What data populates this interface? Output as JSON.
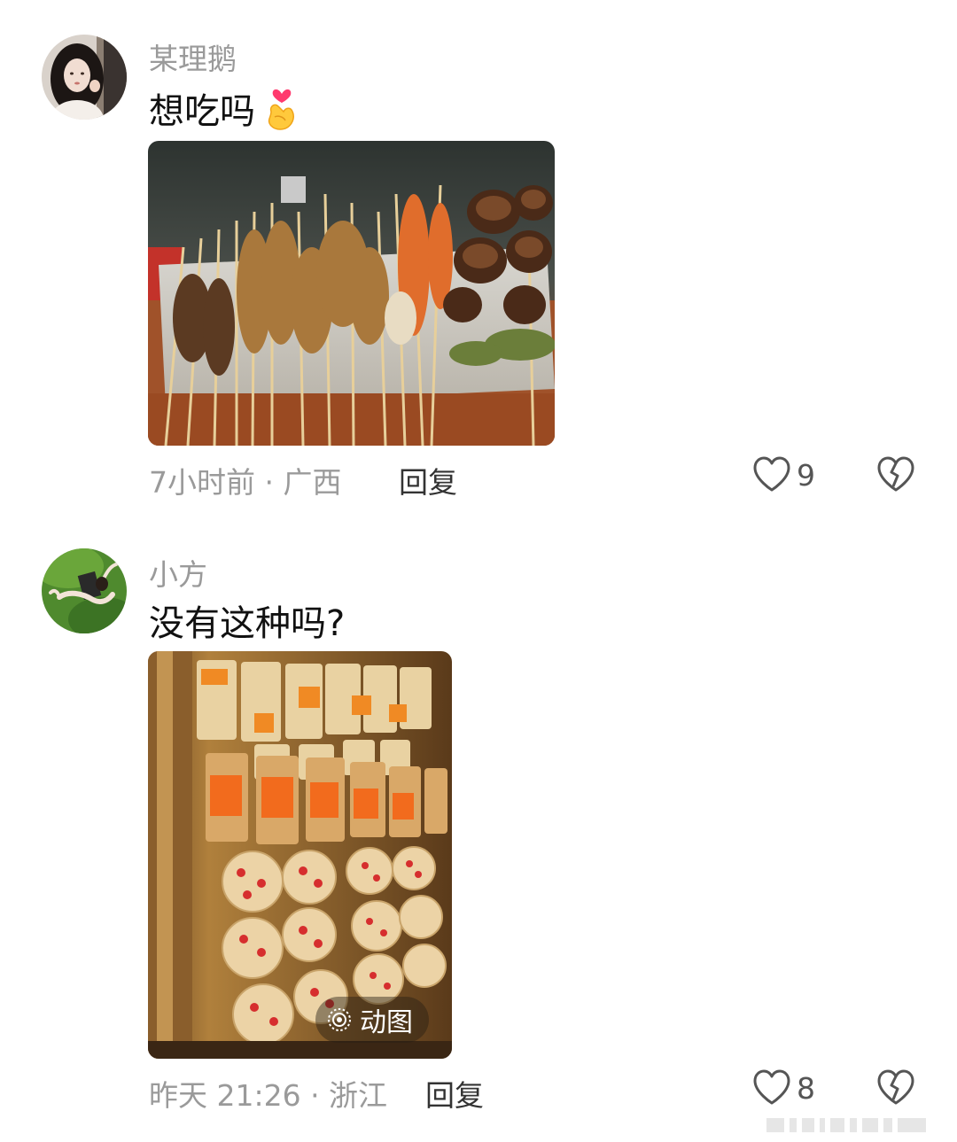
{
  "comments": [
    {
      "username": "某理鹅",
      "text": "想吃吗",
      "emoji": "finger-heart-emoji",
      "meta": "7小时前 · 广西",
      "reply_label": "回复",
      "likes": "9"
    },
    {
      "username": "小方",
      "text": "没有这种吗?",
      "meta": "昨天 21:26 · 浙江",
      "reply_label": "回复",
      "likes": "8",
      "gif_label": "动图"
    }
  ],
  "icons": {
    "like": "heart-outline-icon",
    "dislike": "broken-heart-icon",
    "gif": "live-photo-icon"
  },
  "colors": {
    "username": "#9a9a9a",
    "meta": "#9a9a9a",
    "reply": "#333333",
    "text": "#111111"
  }
}
